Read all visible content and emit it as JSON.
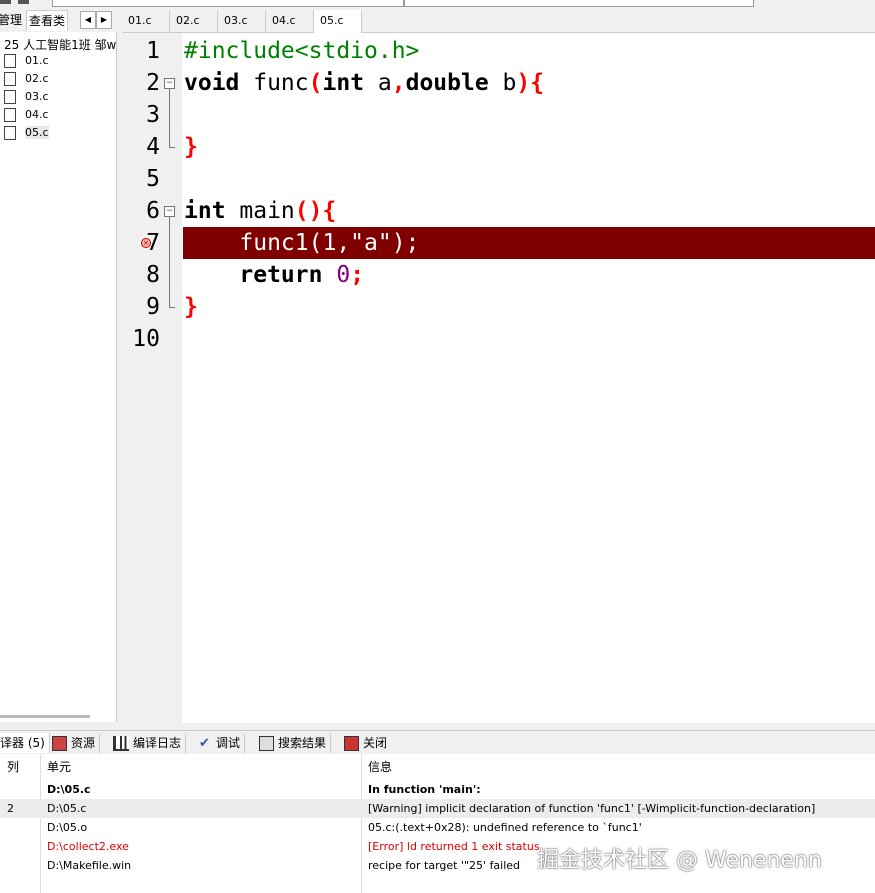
{
  "left_panel": {
    "tabs": [
      "管理",
      "查看类"
    ],
    "project": "25 人工智能1班 邹w",
    "files": [
      "01.c",
      "02.c",
      "03.c",
      "04.c",
      "05.c"
    ],
    "selected_file": "05.c"
  },
  "editor": {
    "tabs": [
      "01.c",
      "02.c",
      "03.c",
      "04.c",
      "05.c"
    ],
    "active_tab": "05.c",
    "line_numbers": [
      "1",
      "2",
      "3",
      "4",
      "5",
      "6",
      "7",
      "8",
      "9",
      "10"
    ],
    "error_line": 7,
    "lines": {
      "l1_include": "#include<stdio.h>",
      "l2_void": "void",
      "l2_func": " func",
      "l2_paren_open": "(",
      "l2_int": "int",
      "l2_a": " a",
      "l2_comma": ",",
      "l2_double": "double",
      "l2_b": " b",
      "l2_close": "){",
      "l4_brace": "}",
      "l6_int": "int",
      "l6_main": " main",
      "l6_open": "(){",
      "l7_call": "    func1(1,\"a\");",
      "l8_return": "    return",
      "l8_zero": " 0",
      "l8_semi": ";",
      "l9_brace": "}"
    }
  },
  "bottom_panel": {
    "tabs": [
      "译器 (5)",
      "资源",
      "编译日志",
      "调试",
      "搜索结果",
      "关闭"
    ],
    "columns": [
      "列",
      "单元",
      "信息"
    ],
    "rows": [
      {
        "col": "",
        "unit": "D:\\05.c",
        "info": "In function 'main':",
        "style": "bold"
      },
      {
        "col": "2",
        "unit": "D:\\05.c",
        "info": "[Warning] implicit declaration of function 'func1' [-Wimplicit-function-declaration]",
        "style": "normal"
      },
      {
        "col": "",
        "unit": "D:\\05.o",
        "info": "05.c:(.text+0x28): undefined reference to `func1'",
        "style": "normal"
      },
      {
        "col": "",
        "unit": "D:\\collect2.exe",
        "info": "[Error] ld returned 1 exit status",
        "style": "error"
      },
      {
        "col": "",
        "unit": "D:\\Makefile.win",
        "info": "recipe for target '\"25' failed",
        "style": "normal"
      }
    ]
  },
  "watermark": "掘金技术社区 @ Wenenenn",
  "colors": {
    "error_line_bg": "#800000",
    "keyword": "#000000",
    "preprocessor": "#008000",
    "punctuation": "#ff0000",
    "number": "#800080",
    "error_text": "#e00000"
  }
}
